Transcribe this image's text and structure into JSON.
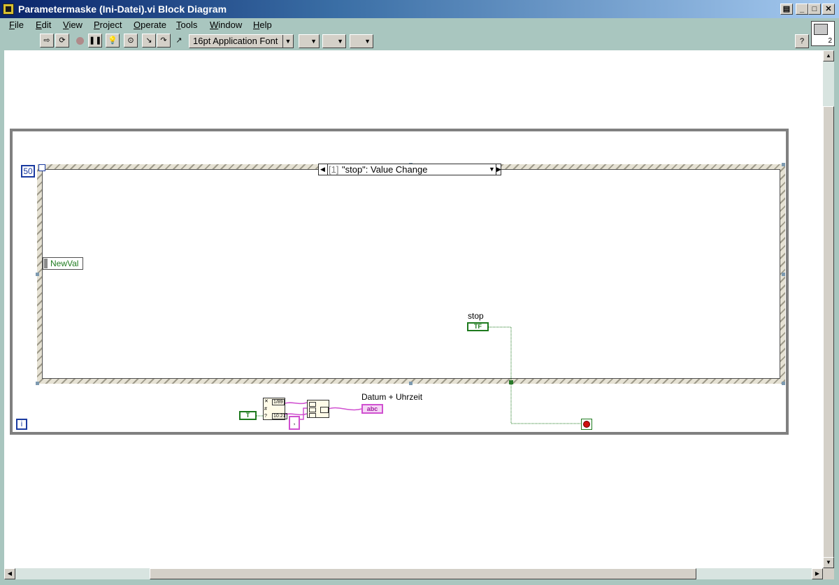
{
  "window": {
    "title": "Parametermaske (Ini-Datei).vi Block Diagram"
  },
  "menu": [
    "File",
    "Edit",
    "View",
    "Project",
    "Operate",
    "Tools",
    "Window",
    "Help"
  ],
  "toolbar": {
    "font_selector": "16pt Application Font",
    "help_label": "?"
  },
  "vi_icon_number": "2",
  "diagram": {
    "loop_count": "50",
    "iteration_terminal": "i",
    "event_case": "[1] \"stop\": Value Change",
    "event_case_index": "[1]",
    "event_case_name": "\"stop\": Value Change",
    "event_data_node": "NewVal",
    "stop_label": "stop",
    "stop_terminal": "TF",
    "datetime_label": "Datum + Uhrzeit",
    "string_indicator": "abc",
    "bool_constant": "T",
    "timestamp_format_date": "1/89",
    "timestamp_format_time": "10:21",
    "separator_constant": ","
  },
  "colors": {
    "titlebar_start": "#0a246a",
    "chrome": "#a9c6bf",
    "boolean_wire": "#1e7a1e",
    "string_wire": "#d050d0",
    "loop_border": "#808080"
  }
}
